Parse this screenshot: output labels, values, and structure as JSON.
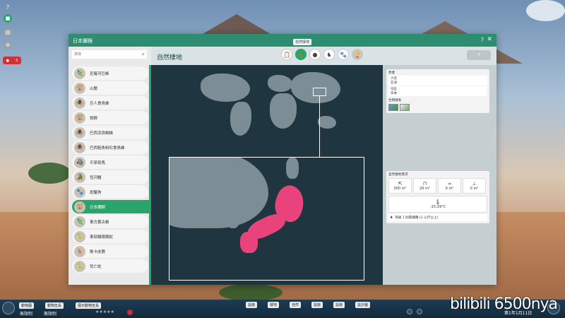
{
  "hud": {
    "help": "?",
    "alert_count": "5"
  },
  "window": {
    "title": "日本獼猴",
    "help": "?",
    "close": "✕"
  },
  "tabs": {
    "tooltip": "自然棲地",
    "section_title": "自然棲地",
    "items": [
      {
        "name": "overview-icon",
        "glyph": "📋"
      },
      {
        "name": "habitat-icon",
        "glyph": "🌴"
      },
      {
        "name": "food-icon",
        "glyph": "●"
      },
      {
        "name": "enrichment-icon",
        "glyph": "♞"
      },
      {
        "name": "social-icon",
        "glyph": "🐾"
      },
      {
        "name": "trophy-icon",
        "glyph": "🏆"
      }
    ]
  },
  "search": {
    "placeholder": "搜尋",
    "icon": "🔍"
  },
  "species_list": [
    {
      "name": "尼羅河巨蜥",
      "glyph": "🦎"
    },
    {
      "name": "山魈",
      "glyph": "🐒"
    },
    {
      "name": "巨人食鳥蛛",
      "glyph": "🕷"
    },
    {
      "name": "狨猴",
      "glyph": "🐒"
    },
    {
      "name": "巴西流浪蜘蛛",
      "glyph": "🕷"
    },
    {
      "name": "巴西鮭魚粉紅食鳥蛛",
      "glyph": "🕷"
    },
    {
      "name": "平原斑馬",
      "glyph": "🦓"
    },
    {
      "name": "恆河鱷",
      "glyph": "🐊"
    },
    {
      "name": "斑鬣狗",
      "glyph": "🐾"
    },
    {
      "name": "日本獼猴",
      "glyph": "🐒",
      "selected": true
    },
    {
      "name": "東方菱古蜥",
      "glyph": "🦎"
    },
    {
      "name": "東部擬眼鏡蛇",
      "glyph": "🐍"
    },
    {
      "name": "歌卡皮鹿",
      "glyph": "🦌"
    },
    {
      "name": "死亡蛇",
      "glyph": "🐍"
    }
  ],
  "info": {
    "origin_label": "原產",
    "continent_key": "大陸",
    "continent_value": "亞洲",
    "region_key": "地區",
    "region_value": "日本",
    "biome_label": "生物群系",
    "req_label": "自然棲地需求",
    "req_values": [
      "300 m²",
      "20 m²",
      "0 m²",
      "0 m²"
    ],
    "temp_value": "-15-29°C",
    "wild_label": "等級 1 則開播種 (2 公尺以上)"
  },
  "bottom": {
    "left_items": [
      "動物園",
      "動物伍長",
      "展示動物伍長"
    ],
    "limit_1": "無限制",
    "limit_2": "無限制",
    "tool_items": [
      "設施",
      "棲地",
      "自然",
      "設施",
      "設施",
      "設計圖"
    ],
    "watermark": "bilibili 6500nya",
    "date": "第1年1月11日"
  },
  "colors": {
    "accent": "#2aa56a",
    "header": "#2e8c70",
    "map_bg": "#1f3540",
    "land": "#7d8d96",
    "habitat": "#e8437a"
  }
}
